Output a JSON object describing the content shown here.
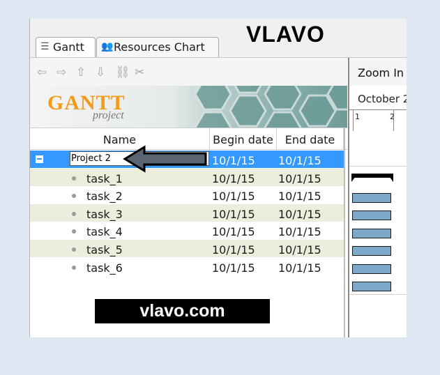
{
  "tabs": [
    {
      "label": "Gantt",
      "icon": "gantt-tree-icon"
    },
    {
      "label": "Resources Chart",
      "icon": "people-icon"
    }
  ],
  "brand_title": "VLAVO",
  "toolbar": {
    "icons": [
      "arrow-left-icon",
      "arrow-right-icon",
      "arrow-up-icon",
      "arrow-down-icon",
      "link-icon",
      "unlink-icon"
    ]
  },
  "logo": {
    "main": "GANTT",
    "sub": "project"
  },
  "columns": {
    "name": "Name",
    "begin": "Begin date",
    "end": "End date"
  },
  "project": {
    "name_edit_value": "Project 2",
    "begin": "10/1/15",
    "end": "10/1/15"
  },
  "tasks": [
    {
      "name": "task_1",
      "begin": "10/1/15",
      "end": "10/1/15"
    },
    {
      "name": "task_2",
      "begin": "10/1/15",
      "end": "10/1/15"
    },
    {
      "name": "task_3",
      "begin": "10/1/15",
      "end": "10/1/15"
    },
    {
      "name": "task_4",
      "begin": "10/1/15",
      "end": "10/1/15"
    },
    {
      "name": "task_5",
      "begin": "10/1/15",
      "end": "10/1/15"
    },
    {
      "name": "task_6",
      "begin": "10/1/15",
      "end": "10/1/15"
    }
  ],
  "chart": {
    "zoom_label": "Zoom In",
    "month": "October 2",
    "days": [
      "1",
      "2"
    ]
  },
  "watermark": "vlavo.com",
  "colors": {
    "selection": "#3399ff",
    "alt_row": "#ededde",
    "bar": "#7ea8c8",
    "logo": "#f29a1a"
  }
}
